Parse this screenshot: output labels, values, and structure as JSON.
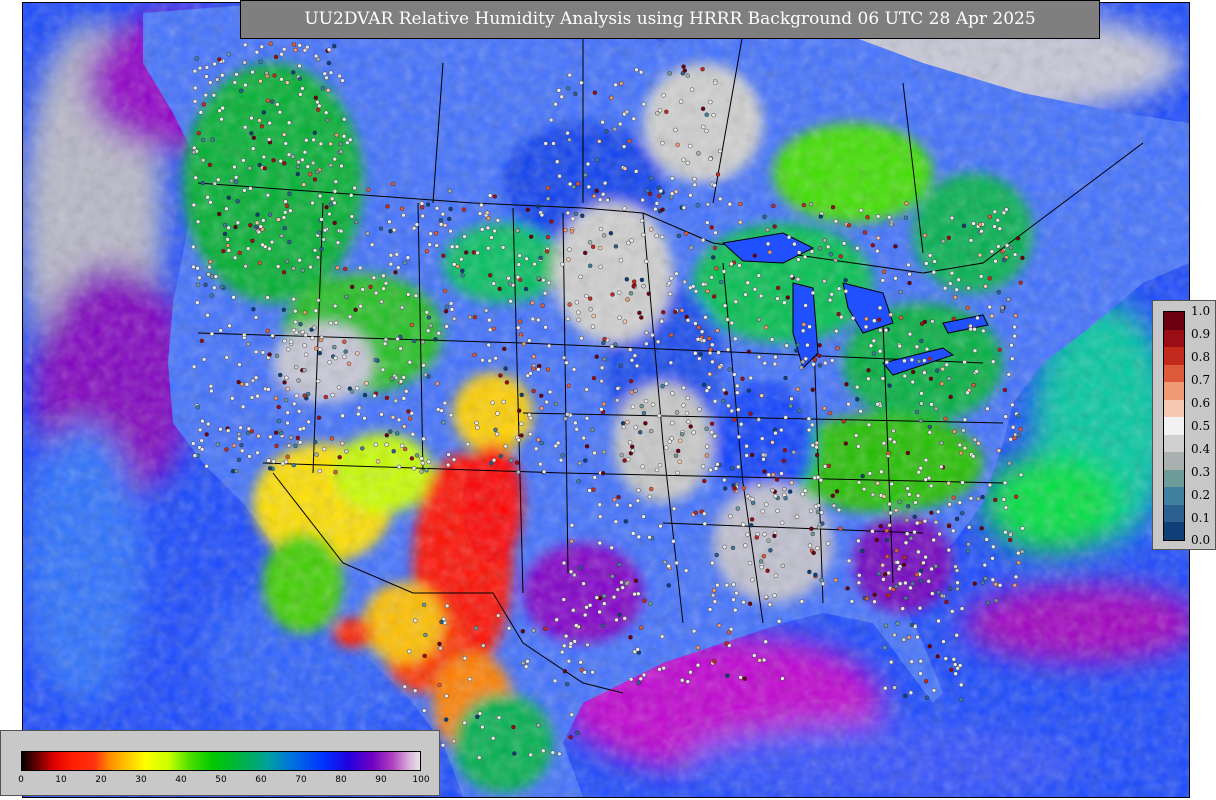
{
  "map": {
    "title": "UU2DVAR Relative Humidity Analysis using HRRR Background 06 UTC 28 Apr 2025",
    "field_name": "relative humidity",
    "colors": {
      "ocean_humid": "#7a00c0",
      "ocean_blue": "#1040ff",
      "land_gray": "#c8c8c8",
      "dry_red": "#ff0000",
      "moist_green": "#00c000",
      "border_line": "#000000"
    }
  },
  "rh_colorbar": {
    "ticks": [
      "0",
      "10",
      "20",
      "30",
      "40",
      "50",
      "60",
      "70",
      "80",
      "90",
      "100"
    ]
  },
  "obs_colorbar": {
    "ticks": [
      "1.0",
      "0.9",
      "0.8",
      "0.7",
      "0.6",
      "0.5",
      "0.4",
      "0.3",
      "0.2",
      "0.1",
      "0.0"
    ],
    "colors": [
      "#6b0010",
      "#9a0d16",
      "#c22a1e",
      "#dd5a3a",
      "#ef9a72",
      "#f7c8b0",
      "#f2f2f2",
      "#d0d0d0",
      "#a8b0b0",
      "#6f9a9a",
      "#3f7fa0",
      "#2a5f90",
      "#103f78"
    ]
  }
}
